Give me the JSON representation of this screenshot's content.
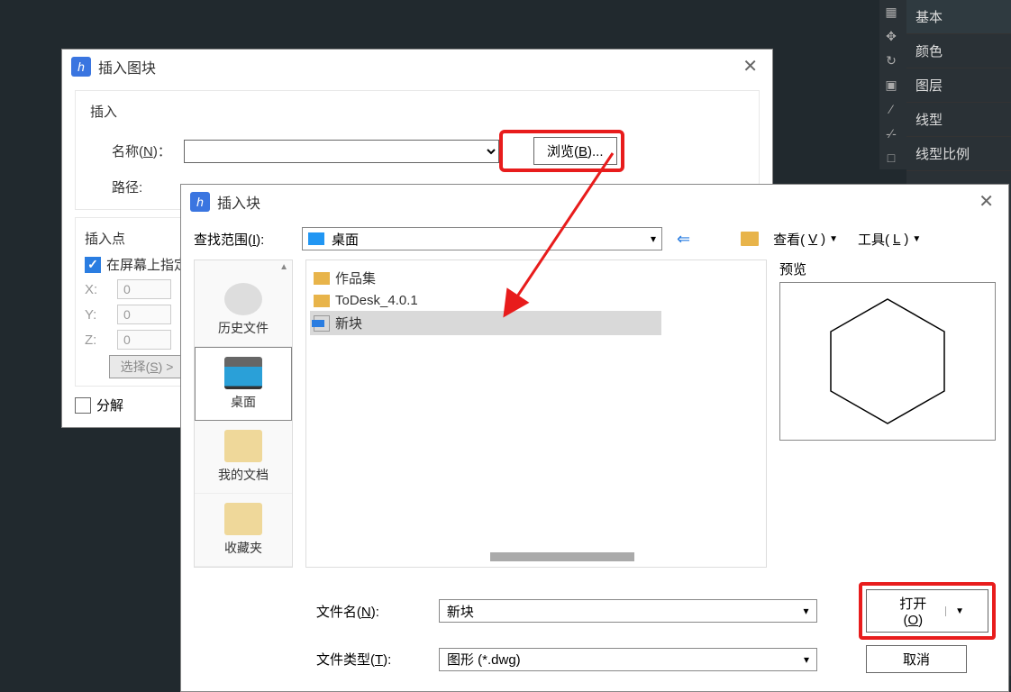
{
  "right_sidebar": {
    "header": "基本",
    "items": [
      "颜色",
      "图层",
      "线型",
      "线型比例"
    ]
  },
  "dialog1": {
    "title": "插入图块",
    "section_insert": "插入",
    "name_label_pre": "名称(",
    "name_label_u": "N",
    "name_label_post": ")：",
    "browse_pre": "浏览(",
    "browse_u": "B",
    "browse_post": ")...",
    "path_label": "路径:",
    "section_insertpt": "插入点",
    "onscreen": "在屏幕上指定",
    "x_label": "X:",
    "x_val": "0",
    "y_label": "Y:",
    "y_val": "0",
    "z_label": "Z:",
    "z_val": "0",
    "select_pre": "选择(",
    "select_u": "S",
    "select_post": ") >",
    "decompose": "分解"
  },
  "dialog2": {
    "title": "插入块",
    "lookin_pre": "查找范围(",
    "lookin_u": "I",
    "lookin_post": "):",
    "lookin_value": "桌面",
    "view_pre": "查看(",
    "view_u": "V",
    "view_post": ")",
    "tools_pre": "工具(",
    "tools_u": "L",
    "tools_post": ")",
    "side_nav": {
      "history": "历史文件",
      "desktop": "桌面",
      "mydocs": "我的文档",
      "favorites": "收藏夹"
    },
    "files": {
      "f1": "作品集",
      "f2": "ToDesk_4.0.1",
      "f3": "新块"
    },
    "preview_label": "预览",
    "filename_pre": "文件名(",
    "filename_u": "N",
    "filename_post": "):",
    "filename_val": "新块",
    "filetype_pre": "文件类型(",
    "filetype_u": "T",
    "filetype_post": "):",
    "filetype_val": "图形 (*.dwg)",
    "open_pre": "打开(",
    "open_u": "O",
    "open_post": ")",
    "cancel": "取消"
  }
}
